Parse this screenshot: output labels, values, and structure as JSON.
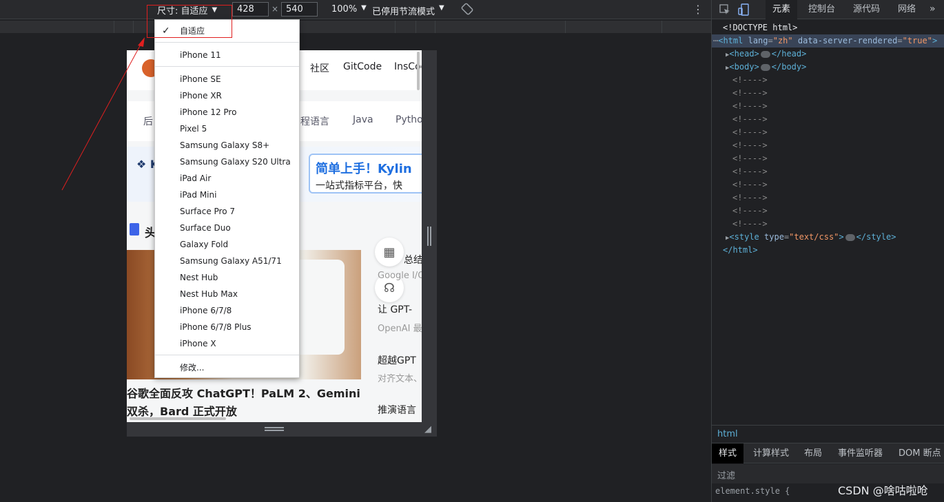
{
  "device_toolbar": {
    "dimensions_label": "尺寸: 自适应",
    "width_value": "428",
    "height_value": "540",
    "times_symbol": "×",
    "zoom": "100%",
    "throttling": "已停用节流模式"
  },
  "dropdown": {
    "selected": "自适应",
    "group1": [
      "iPhone 11"
    ],
    "devices": [
      "iPhone SE",
      "iPhone XR",
      "iPhone 12 Pro",
      "Pixel 5",
      "Samsung Galaxy S8+",
      "Samsung Galaxy S20 Ultra",
      "iPad Air",
      "iPad Mini",
      "Surface Pro 7",
      "Surface Duo",
      "Galaxy Fold",
      "Samsung Galaxy A51/71",
      "Nest Hub",
      "Nest Hub Max",
      "iPhone 6/7/8",
      "iPhone 6/7/8 Plus",
      "iPhone X"
    ],
    "edit": "修改..."
  },
  "viewport": {
    "nav": [
      "社区",
      "GitCode",
      "InsCode"
    ],
    "categories": [
      "后",
      "程语言",
      "Java",
      "Pytho"
    ],
    "banner_k": "❖ K",
    "banner_title": "简单上手！Kylin",
    "banner_sub": "一站式指标平台，快",
    "section_title": "头",
    "article_title": "谷歌全面反攻 ChatGPT！PaLM 2、Gemini 双杀，Bard 正式开放",
    "right_items": [
      {
        "title": "总结",
        "sub": "Google I/O"
      },
      {
        "title": "让 GPT-",
        "sub": "OpenAI 最"
      },
      {
        "title": "超越GPT",
        "sub": "对齐文本、"
      },
      {
        "title": "推演语言",
        "sub": ""
      }
    ]
  },
  "devtools": {
    "tabs": [
      "元素",
      "控制台",
      "源代码",
      "网络"
    ],
    "dom": {
      "doctype": "<!DOCTYPE html>",
      "html_open": "<html",
      "lang_attr": "lang",
      "lang_val": "\"zh\"",
      "ssr_attr": "data-server-rendered",
      "ssr_val": "\"true\"",
      "head": "<head>",
      "head_close": "</head>",
      "body": "<body>",
      "body_close": "</body>",
      "comment": "<!---->",
      "style_open": "<style",
      "type_attr": "type",
      "type_val": "\"text/css\"",
      "style_close": "</style>",
      "html_close": "</html>"
    },
    "breadcrumb": "html",
    "style_tabs": [
      "样式",
      "计算样式",
      "布局",
      "事件监听器",
      "DOM 断点"
    ],
    "filter_placeholder": "过滤",
    "element_style": "element.style {"
  },
  "watermark": "CSDN @啥咕啦呛",
  "colors": {
    "highlight": "#e01f1f",
    "selected_row": "#394457",
    "tag": "#5db0d7"
  }
}
